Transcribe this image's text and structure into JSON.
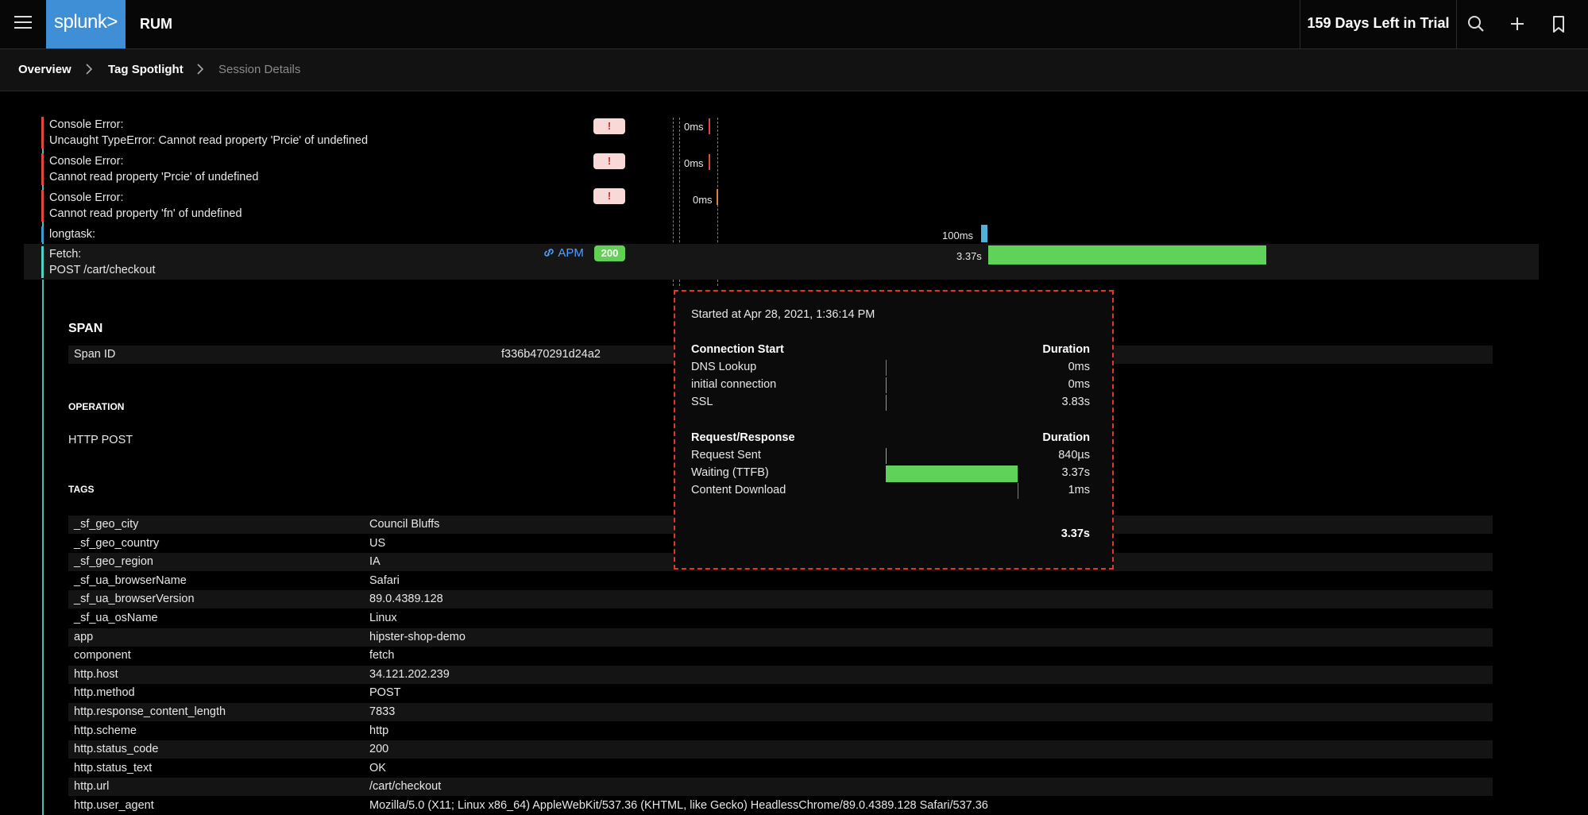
{
  "header": {
    "logo_text": "splunk>",
    "app_name": "RUM",
    "trial_text": "159 Days Left in Trial",
    "icons": [
      "menu-icon",
      "search-icon",
      "plus-icon",
      "bookmark-icon"
    ]
  },
  "breadcrumb": {
    "items": [
      "Overview",
      "Tag Spotlight",
      "Session Details"
    ]
  },
  "events": [
    {
      "type": "Console Error:",
      "message": "Uncaught TypeError: Cannot read property 'Prcie' of undefined",
      "badge": "!",
      "duration": "0ms"
    },
    {
      "type": "Console Error:",
      "message": "Cannot read property 'Prcie' of undefined",
      "badge": "!",
      "duration": "0ms"
    },
    {
      "type": "Console Error:",
      "message": "Cannot read property 'fn' of undefined",
      "badge": "!",
      "duration": "0ms"
    },
    {
      "type": "longtask:",
      "duration": "100ms"
    },
    {
      "type": "Fetch:",
      "message": "POST /cart/checkout",
      "link": "APM",
      "status": "200",
      "duration": "3.37s"
    }
  ],
  "span": {
    "title": "SPAN",
    "span_id_label": "Span ID",
    "span_id": "f336b470291d24a2",
    "operation_label": "OPERATION",
    "operation": "HTTP POST",
    "tags_label": "TAGS",
    "tags": [
      {
        "key": "_sf_geo_city",
        "value": "Council Bluffs"
      },
      {
        "key": "_sf_geo_country",
        "value": "US"
      },
      {
        "key": "_sf_geo_region",
        "value": "IA"
      },
      {
        "key": "_sf_ua_browserName",
        "value": "Safari"
      },
      {
        "key": "_sf_ua_browserVersion",
        "value": "89.0.4389.128"
      },
      {
        "key": "_sf_ua_osName",
        "value": "Linux"
      },
      {
        "key": "app",
        "value": "hipster-shop-demo"
      },
      {
        "key": "component",
        "value": "fetch"
      },
      {
        "key": "http.host",
        "value": "34.121.202.239"
      },
      {
        "key": "http.method",
        "value": "POST"
      },
      {
        "key": "http.response_content_length",
        "value": "7833"
      },
      {
        "key": "http.scheme",
        "value": "http"
      },
      {
        "key": "http.status_code",
        "value": "200"
      },
      {
        "key": "http.status_text",
        "value": "OK"
      },
      {
        "key": "http.url",
        "value": "/cart/checkout"
      },
      {
        "key": "http.user_agent",
        "value": "Mozilla/5.0 (X11; Linux x86_64) AppleWebKit/537.36 (KHTML, like Gecko) HeadlessChrome/89.0.4389.128 Safari/537.36"
      }
    ]
  },
  "popover": {
    "started": "Started at Apr 28, 2021, 1:36:14 PM",
    "sections": [
      {
        "title": "Connection Start",
        "duration_label": "Duration",
        "rows": [
          {
            "label": "DNS Lookup",
            "value": "0ms"
          },
          {
            "label": "initial connection",
            "value": "0ms"
          },
          {
            "label": "SSL",
            "value": "3.83s"
          }
        ]
      },
      {
        "title": "Request/Response",
        "duration_label": "Duration",
        "rows": [
          {
            "label": "Request Sent",
            "value": "840µs"
          },
          {
            "label": "Waiting (TTFB)",
            "value": "3.37s"
          },
          {
            "label": "Content Download",
            "value": "1ms"
          }
        ]
      }
    ],
    "total": "3.37s"
  },
  "colors": {
    "accent": "#3e8fd6",
    "error": "#e0483f",
    "success": "#62d054",
    "link": "#4da0ff",
    "timeline": "#4fd1c5"
  }
}
